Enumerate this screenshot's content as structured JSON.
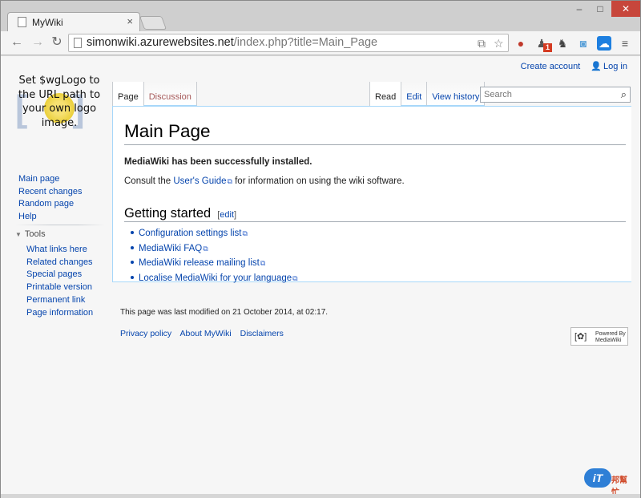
{
  "browser": {
    "tab_title": "MyWiki",
    "tab_close": "×",
    "url_host": "simonwiki.azurewebsites.net",
    "url_path": "/index.php?title=Main_Page",
    "window_controls": {
      "minimize": "–",
      "maximize": "□",
      "close": "✕"
    },
    "icons": [
      "back-icon",
      "forward-icon",
      "reload-icon",
      "translate-icon",
      "star-icon",
      "extension-pin-icon",
      "extension-bell-icon",
      "extension-elephant-icon",
      "extension-camera-icon",
      "extension-cloud-icon",
      "menu-icon"
    ],
    "badge": "1"
  },
  "wiki": {
    "user_links": {
      "create_account": "Create account",
      "log_in": "Log in"
    },
    "logo_text": "Set $wgLogo to the URL path to your own logo image.",
    "nav": [
      "Main page",
      "Recent changes",
      "Random page",
      "Help"
    ],
    "tools_label": "Tools",
    "tools": [
      "What links here",
      "Related changes",
      "Special pages",
      "Printable version",
      "Permanent link",
      "Page information"
    ],
    "tabs_left": [
      "Page",
      "Discussion"
    ],
    "tabs_right": [
      "Read",
      "Edit",
      "View history"
    ],
    "search_placeholder": "Search",
    "page_title": "Main Page",
    "installed_msg": "MediaWiki has been successfully installed.",
    "guide_before": "Consult the ",
    "guide_link": "User's Guide",
    "guide_after": " for information on using the wiki software.",
    "section_title": "Getting started",
    "edit_label": "edit",
    "list": [
      "Configuration settings list",
      "MediaWiki FAQ",
      "MediaWiki release mailing list",
      "Localise MediaWiki for your language"
    ],
    "last_modified": "This page was last modified on 21 October 2014, at 02:17.",
    "footer_links": [
      "Privacy policy",
      "About MyWiki",
      "Disclaimers"
    ],
    "powered_by": {
      "line1": "Powered By",
      "line2": "MediaWiki"
    }
  },
  "watermark": {
    "it": "iT",
    "rest": "邦幫忙"
  },
  "colors": {
    "link": "#0645ad",
    "new_link": "#a55858",
    "tab_border": "#a7d7f9",
    "close_button": "#c7463b"
  }
}
